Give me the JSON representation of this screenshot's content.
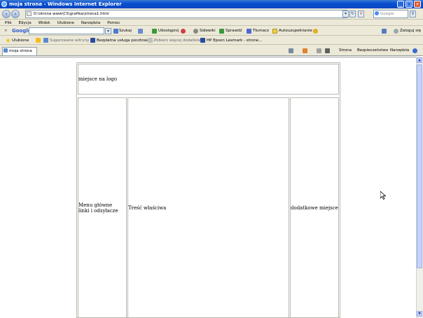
{
  "window": {
    "title": "moja strona - Windows Internet Explorer"
  },
  "address": {
    "url": "D:\\strona www\\CS\\grafika\\strona1.html",
    "search_placeholder": "Google"
  },
  "menu": [
    "Plik",
    "Edycja",
    "Widok",
    "Ulubione",
    "Narzędzia",
    "Pomoc"
  ],
  "google_toolbar": {
    "logo": "Google",
    "search_btn": "Szukaj",
    "share": "Udostępnij",
    "sidewiki": "Sidewiki",
    "check": "Sprawdź",
    "translate": "Tłumacz",
    "autofill": "Autouzupełnianie",
    "signin": "Zaloguj się"
  },
  "favorites": {
    "label": "Ulubione",
    "items": [
      "Sugerowane witryny",
      "Bezpłatna usługa pocztowa ...",
      "Pobierz więcej dodatków",
      "HP Epson Lexmark - strone..."
    ]
  },
  "tab": {
    "label": "moja strona"
  },
  "command_bar": {
    "page": "Strona",
    "safety": "Bezpieczeństwo",
    "tools": "Narzędzia"
  },
  "page": {
    "logo": "miejsce na logo",
    "menu_line1": "Menu główne",
    "menu_line2": "linki i odsyłacze",
    "content": "Treść właściwa",
    "extra": "dodatkowe miejsce"
  }
}
